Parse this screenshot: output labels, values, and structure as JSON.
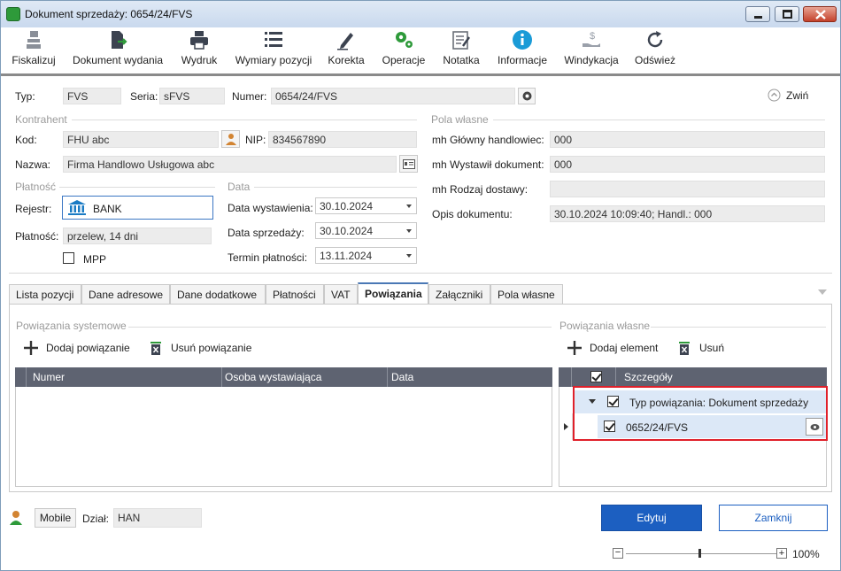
{
  "window": {
    "title": "Dokument sprzedaży: 0654/24/FVS"
  },
  "toolbar": {
    "items": [
      {
        "label": "Fiskalizuj",
        "icon": "cash-register-icon"
      },
      {
        "label": "Dokument wydania",
        "icon": "document-export-icon"
      },
      {
        "label": "Wydruk",
        "icon": "printer-icon"
      },
      {
        "label": "Wymiary pozycji",
        "icon": "list-icon"
      },
      {
        "label": "Korekta",
        "icon": "pencil-icon"
      },
      {
        "label": "Operacje",
        "icon": "gears-icon"
      },
      {
        "label": "Notatka",
        "icon": "note-icon"
      },
      {
        "label": "Informacje",
        "icon": "info-icon"
      },
      {
        "label": "Windykacja",
        "icon": "money-hand-icon"
      },
      {
        "label": "Odśwież",
        "icon": "refresh-icon"
      }
    ]
  },
  "header": {
    "typ_label": "Typ:",
    "typ_value": "FVS",
    "seria_label": "Seria:",
    "seria_value": "sFVS",
    "numer_label": "Numer:",
    "numer_value": "0654/24/FVS",
    "collapse_label": "Zwiń"
  },
  "kontrahent": {
    "section": "Kontrahent",
    "kod_label": "Kod:",
    "kod_value": "FHU abc",
    "nip_label": "NIP:",
    "nip_value": "834567890",
    "nazwa_label": "Nazwa:",
    "nazwa_value": "Firma Handlowo Usługowa abc"
  },
  "platnosc": {
    "section": "Płatność",
    "rejestr_label": "Rejestr:",
    "rejestr_value": "BANK",
    "platnosc_label": "Płatność:",
    "platnosc_value": "przelew, 14 dni",
    "mpp_label": "MPP"
  },
  "data": {
    "section": "Data",
    "wystawienia_label": "Data wystawienia:",
    "wystawienia_value": "30.10.2024",
    "sprzedazy_label": "Data sprzedaży:",
    "sprzedazy_value": "30.10.2024",
    "termin_label": "Termin płatności:",
    "termin_value": "13.11.2024"
  },
  "pola_wlasne": {
    "section": "Pola własne",
    "handlowiec_label": "mh Główny handlowiec:",
    "handlowiec_value": "000",
    "wystawil_label": "mh Wystawił dokument:",
    "wystawil_value": "000",
    "dostawa_label": "mh Rodzaj dostawy:",
    "dostawa_value": "",
    "opis_label": "Opis dokumentu:",
    "opis_value": "30.10.2024 10:09:40; Handl.: 000"
  },
  "tabs": [
    "Lista pozycji",
    "Dane adresowe",
    "Dane dodatkowe",
    "Płatności",
    "VAT",
    "Powiązania",
    "Załączniki",
    "Pola własne"
  ],
  "powiazania_systemowe": {
    "section": "Powiązania systemowe",
    "add_label": "Dodaj powiązanie",
    "remove_label": "Usuń powiązanie",
    "columns": [
      "Numer",
      "Osoba wystawiająca",
      "Data"
    ]
  },
  "powiazania_wlasne": {
    "section": "Powiązania własne",
    "add_label": "Dodaj element",
    "remove_label": "Usuń",
    "column": "Szczegóły",
    "group_label": "Typ powiązania: Dokument sprzedaży",
    "row_value": "0652/24/FVS"
  },
  "footer": {
    "mobile_label": "Mobile",
    "dzial_label": "Dział:",
    "dzial_value": "HAN",
    "edit_label": "Edytuj",
    "close_label": "Zamknij",
    "zoom_minus": "−",
    "zoom_plus": "+",
    "zoom_value": "100%"
  },
  "colors": {
    "accent": "#1c5fc1",
    "grid_header": "#5e6371",
    "highlight_border": "#e0202a",
    "selected_row": "#dce8f7"
  }
}
